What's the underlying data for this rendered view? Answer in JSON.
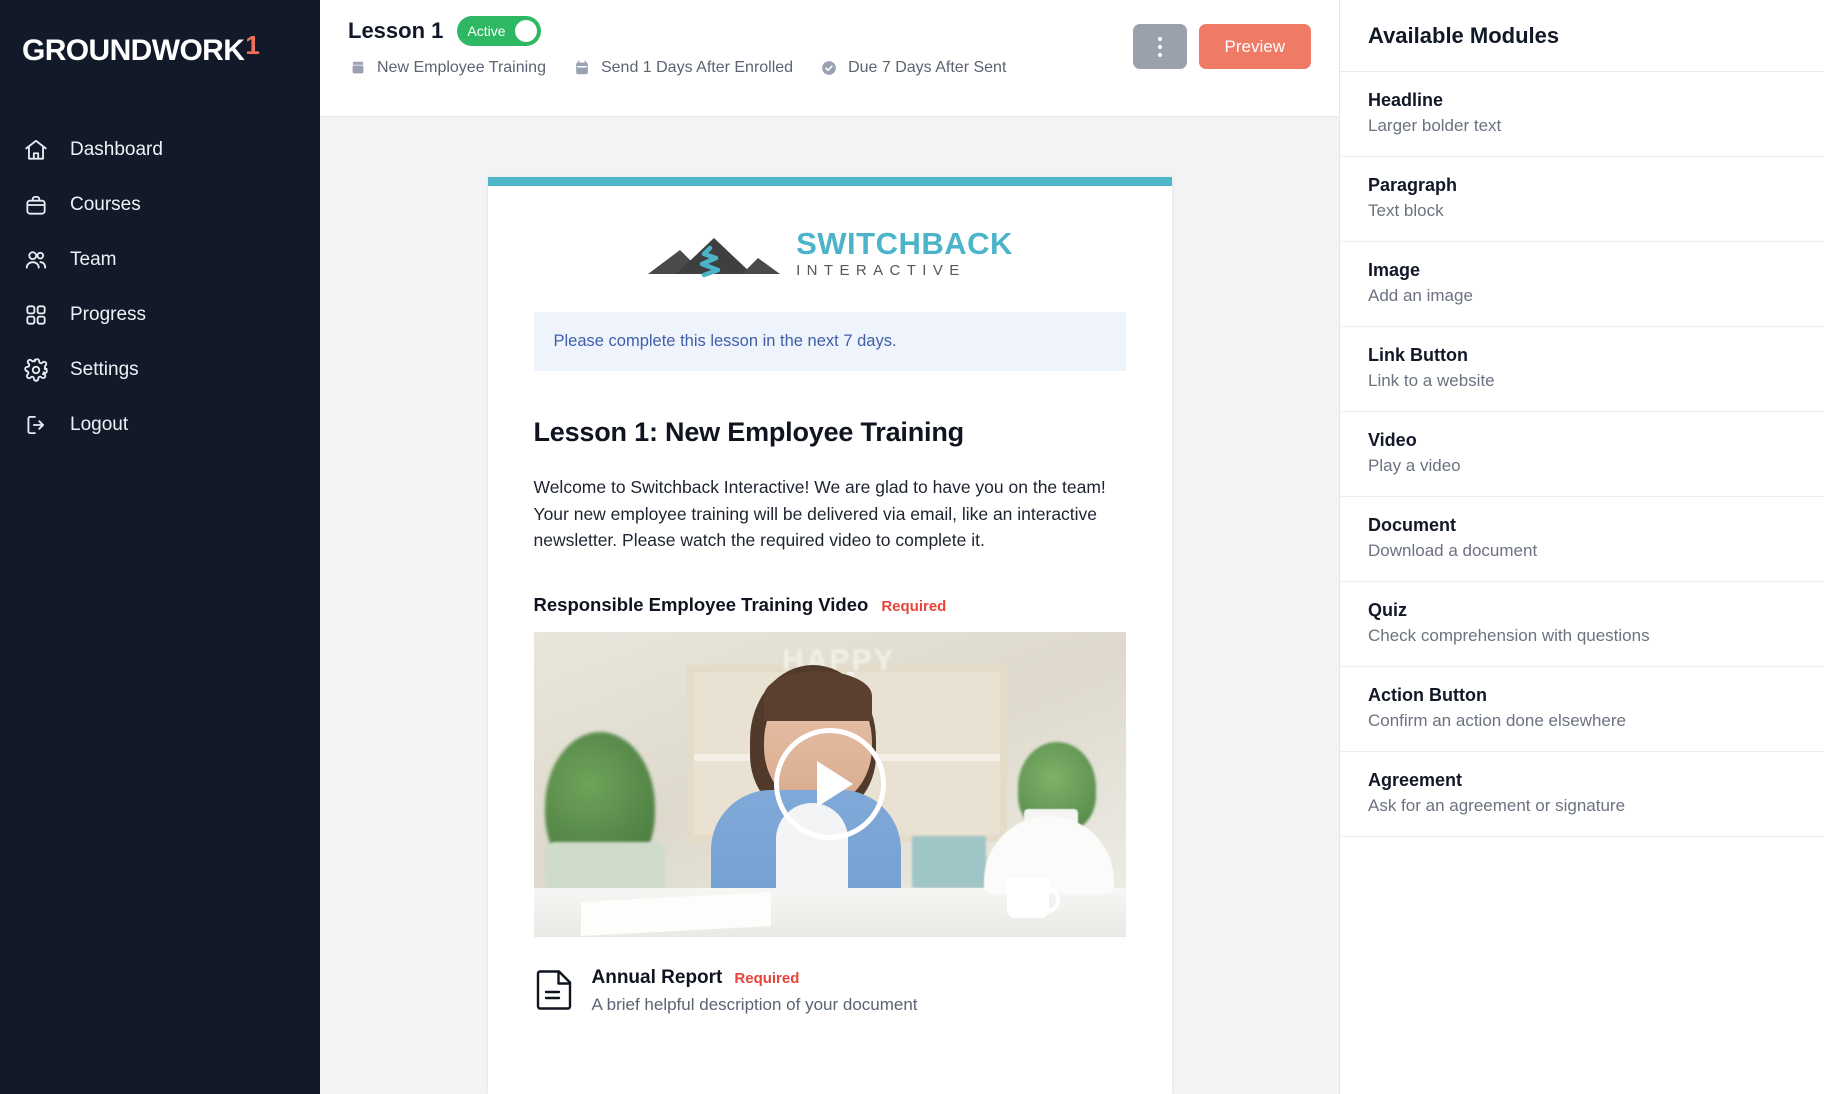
{
  "sidebar": {
    "brand": {
      "word": "GROUNDWORK",
      "mark": "1"
    },
    "items": [
      {
        "label": "Dashboard",
        "icon": "home-icon"
      },
      {
        "label": "Courses",
        "icon": "briefcase-icon"
      },
      {
        "label": "Team",
        "icon": "users-icon"
      },
      {
        "label": "Progress",
        "icon": "grid-icon"
      },
      {
        "label": "Settings",
        "icon": "gear-icon"
      },
      {
        "label": "Logout",
        "icon": "logout-icon"
      }
    ]
  },
  "topbar": {
    "lesson_title": "Lesson 1",
    "toggle_label": "Active",
    "meta": [
      {
        "icon": "course-icon",
        "label": "New Employee Training"
      },
      {
        "icon": "calendar-icon",
        "label": "Send 1 Days After Enrolled"
      },
      {
        "icon": "check-circle-icon",
        "label": "Due 7 Days After Sent"
      }
    ],
    "kebab_label": "More options",
    "preview_label": "Preview"
  },
  "email": {
    "logo": {
      "top": "SWITCHBACK",
      "sub": "INTERACTIVE"
    },
    "notice": "Please complete this lesson in the next 7 days.",
    "heading": "Lesson 1: New Employee Training",
    "paragraph": "Welcome to Switchback Interactive! We are glad to have you on the team! Your new employee training will be delivered via email, like an interactive newsletter. Please watch the required video to complete it.",
    "video": {
      "title": "Responsible Employee Training Video",
      "required_badge": "Required",
      "overlay_text": "HAPPY",
      "play_label": "Play video"
    },
    "document": {
      "title": "Annual Report",
      "required_badge": "Required",
      "description": "A brief helpful description of your document"
    }
  },
  "right_panel": {
    "title": "Available Modules",
    "modules": [
      {
        "name": "Headline",
        "desc": "Larger bolder text"
      },
      {
        "name": "Paragraph",
        "desc": "Text block"
      },
      {
        "name": "Image",
        "desc": "Add an image"
      },
      {
        "name": "Link Button",
        "desc": "Link to a website"
      },
      {
        "name": "Video",
        "desc": "Play a video"
      },
      {
        "name": "Document",
        "desc": "Download a document"
      },
      {
        "name": "Quiz",
        "desc": "Check comprehension with questions"
      },
      {
        "name": "Action Button",
        "desc": "Confirm an action done elsewhere"
      },
      {
        "name": "Agreement",
        "desc": "Ask for an agreement or signature"
      }
    ]
  },
  "colors": {
    "sidebar_bg": "#121a2a",
    "brand_mark": "#f0705c",
    "toggle_active": "#2fb863",
    "preview_btn": "#ef7a66",
    "email_accent": "#4eb8c9",
    "logo_teal": "#4bb4c8",
    "notice_bg": "#eef3fc",
    "notice_text": "#3f5fa8",
    "required_red": "#e8443a"
  }
}
